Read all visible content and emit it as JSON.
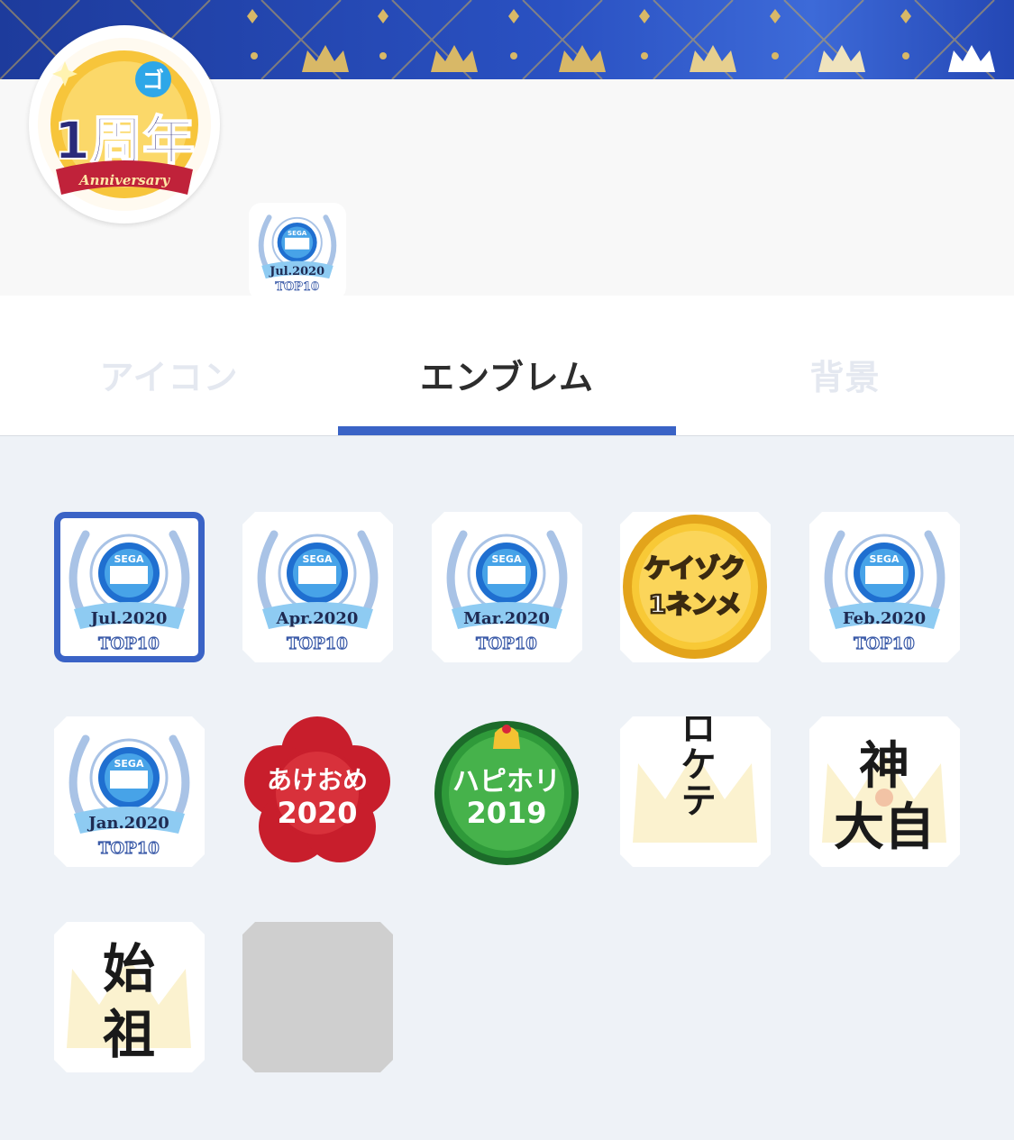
{
  "tabs": [
    {
      "label": "アイコン",
      "active": false
    },
    {
      "label": "エンブレム",
      "active": true
    },
    {
      "label": "背景",
      "active": false
    }
  ],
  "avatar": {
    "badge_main": "1周年",
    "badge_sub": "Anniversary",
    "badge_glyph": "ゴ"
  },
  "equipped_emblem": {
    "month": "Jul.2020",
    "rank": "TOP10",
    "brand": "SEGA"
  },
  "emblems": [
    {
      "type": "ranking",
      "month": "Jul.2020",
      "rank": "TOP10",
      "brand": "SEGA",
      "selected": true
    },
    {
      "type": "ranking",
      "month": "Apr.2020",
      "rank": "TOP10",
      "brand": "SEGA",
      "selected": false
    },
    {
      "type": "ranking",
      "month": "Mar.2020",
      "rank": "TOP10",
      "brand": "SEGA",
      "selected": false
    },
    {
      "type": "coin",
      "line1": "ケイゾク",
      "line2": "1ネンメ",
      "selected": false
    },
    {
      "type": "ranking",
      "month": "Feb.2020",
      "rank": "TOP10",
      "brand": "SEGA",
      "selected": false
    },
    {
      "type": "ranking",
      "month": "Jan.2020",
      "rank": "TOP10",
      "brand": "SEGA",
      "selected": false
    },
    {
      "type": "newyear",
      "line1": "あけおめ",
      "line2": "2020",
      "selected": false
    },
    {
      "type": "holiday",
      "line1": "ハピホリ",
      "line2": "2019",
      "selected": false
    },
    {
      "type": "crown-text",
      "text": "ロケテ",
      "selected": false
    },
    {
      "type": "crown-text",
      "line1": "神",
      "line2": "大自",
      "selected": false
    },
    {
      "type": "crown-text",
      "line1": "始",
      "line2": "祖",
      "selected": false
    },
    {
      "type": "empty",
      "selected": false
    }
  ],
  "colors": {
    "accent": "#3a63c6",
    "banner": "#2a51c2",
    "inactive_tab": "#e4e8f0",
    "grid_bg": "#eef2f7"
  }
}
